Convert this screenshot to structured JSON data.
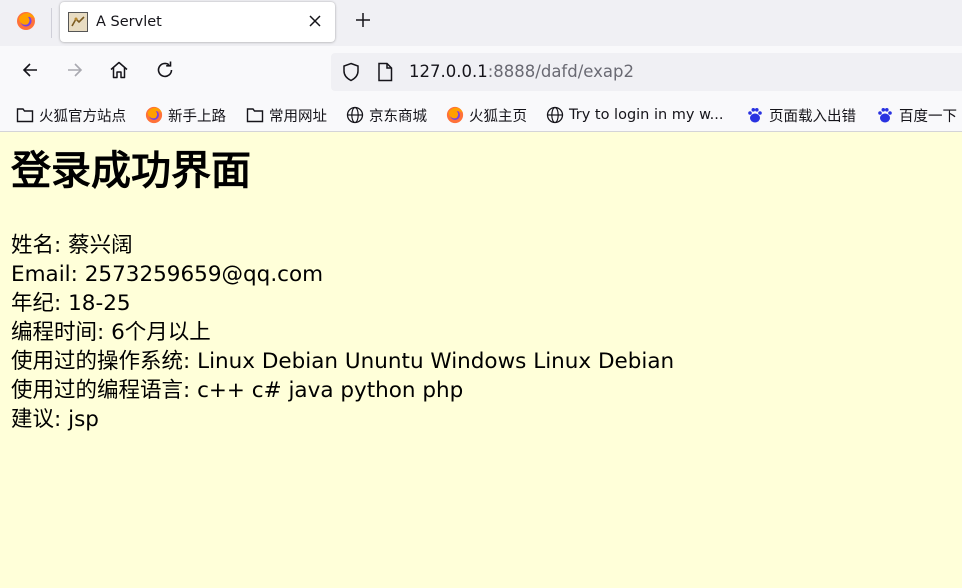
{
  "browser": {
    "tab": {
      "title": "A Servlet",
      "favicon": "servlet-favicon"
    },
    "url": {
      "host": "127.0.0.1",
      "rest": ":8888/dafd/exap2"
    },
    "bookmarks": [
      {
        "label": "火狐官方站点",
        "icon": "folder-icon"
      },
      {
        "label": "新手上路",
        "icon": "firefox-icon"
      },
      {
        "label": "常用网址",
        "icon": "folder-icon"
      },
      {
        "label": "京东商城",
        "icon": "globe-icon"
      },
      {
        "label": "火狐主页",
        "icon": "firefox-icon"
      },
      {
        "label": "Try to login in my w...",
        "icon": "globe-icon"
      },
      {
        "label": "页面载入出错",
        "icon": "baidu-icon"
      },
      {
        "label": "百度一下",
        "icon": "baidu-icon"
      }
    ]
  },
  "page": {
    "heading": "登录成功界面",
    "fields": [
      {
        "label": "姓名",
        "value": "蔡兴阔"
      },
      {
        "label": "Email",
        "value": "2573259659@qq.com"
      },
      {
        "label": "年纪",
        "value": "18-25"
      },
      {
        "label": "编程时间",
        "value": "6个月以上"
      },
      {
        "label": "使用过的操作系统",
        "value": "Linux Debian Ununtu Windows Linux Debian"
      },
      {
        "label": "使用过的编程语言",
        "value": "c++ c# java python php"
      },
      {
        "label": "建议",
        "value": "jsp"
      }
    ],
    "separator": ": "
  },
  "colors": {
    "page_background": "#ffffd9",
    "chrome_background": "#f0f0f4",
    "toolbar_background": "#f9f9fb"
  }
}
